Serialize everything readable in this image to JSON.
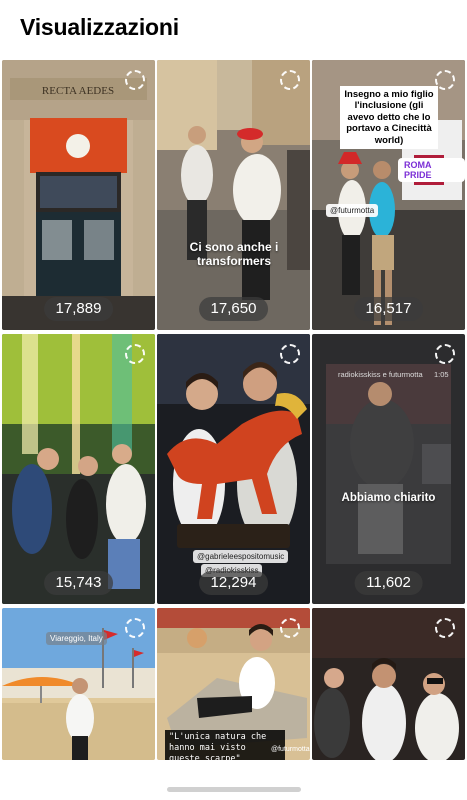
{
  "page": {
    "title": "Visualizzazioni"
  },
  "tiles": [
    {
      "views": "17,889",
      "sign": "RECTA AEDES",
      "caption": "",
      "mini_tag": ""
    },
    {
      "views": "17,650",
      "caption": "Ci sono anche i transformers"
    },
    {
      "views": "16,517",
      "caption": "Insegno a mio figlio l'inclusione (gli avevo detto che lo portavo a Cinecittà world)",
      "badge": "ROMA PRIDE",
      "mention": "@futurmotta"
    },
    {
      "views": "15,743",
      "caption": ""
    },
    {
      "views": "12,294",
      "mention1": "@gabrieleespositomusic",
      "mention2": "@radiokisskiss"
    },
    {
      "views": "11,602",
      "caption": "Abbiamo chiarito",
      "account": "radiokisskiss e futurmotta",
      "time": "1:05"
    },
    {
      "views": "",
      "location": "Viareggio, Italy"
    },
    {
      "views": "",
      "caption": "\"L'unica natura che hanno mai visto queste scarpe\"",
      "mention": "@futurmotta"
    },
    {
      "views": ""
    }
  ],
  "colors": {
    "background": "#ffffff",
    "ring": "#ffffff",
    "badge_bg": "#7b2fd6"
  }
}
